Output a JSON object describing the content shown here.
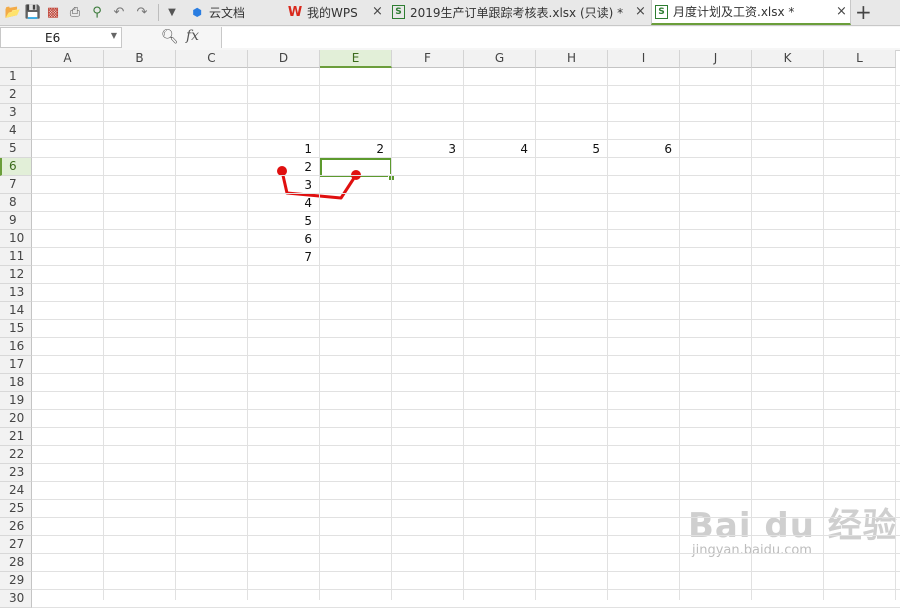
{
  "namebox": {
    "value": "E6"
  },
  "formula": {
    "fx": "fx",
    "value": ""
  },
  "tabs": [
    {
      "label": "云文档",
      "icon": "cloud-cube-icon"
    },
    {
      "label": "我的WPS",
      "icon": "wps-logo-icon"
    },
    {
      "label": "2019生产订单跟踪考核表.xlsx (只读) *",
      "icon": "xlsx-file-icon"
    },
    {
      "label": "月度计划及工资.xlsx *",
      "icon": "xlsx-file-icon"
    }
  ],
  "columns": [
    "A",
    "B",
    "C",
    "D",
    "E",
    "F",
    "G",
    "H",
    "I",
    "J",
    "K",
    "L"
  ],
  "rows": [
    "1",
    "2",
    "3",
    "4",
    "5",
    "6",
    "7",
    "8",
    "9",
    "10",
    "11",
    "12",
    "13",
    "14",
    "15",
    "16",
    "17",
    "18",
    "19",
    "20",
    "21",
    "22",
    "23",
    "24",
    "25",
    "26",
    "27",
    "28",
    "29",
    "30"
  ],
  "cells": {
    "D5": "1",
    "E5": "2",
    "F5": "3",
    "G5": "4",
    "H5": "5",
    "I5": "6",
    "D6": "2",
    "D7": "3",
    "D8": "4",
    "D9": "5",
    "D10": "6",
    "D11": "7"
  },
  "selected": {
    "cell": "E6",
    "column": "E",
    "row": "6",
    "color": "#5d9a2e"
  },
  "annotation": {
    "color": "#e01010"
  },
  "watermark": {
    "brand": "Bai du 经验",
    "url": "jingyan.baidu.com"
  }
}
